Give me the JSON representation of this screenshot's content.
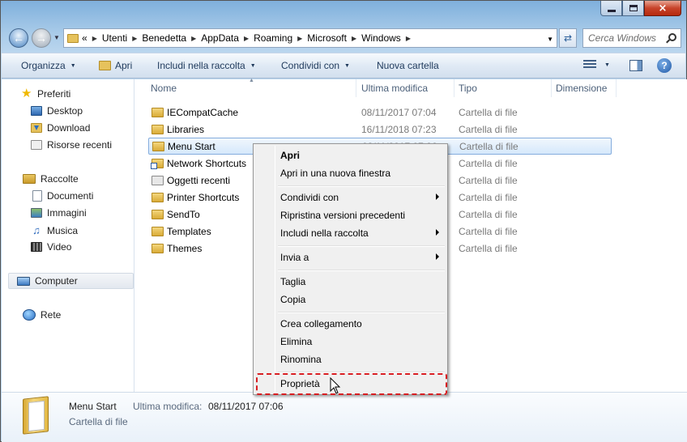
{
  "window": {
    "controls": {
      "minimize": "minimize",
      "maximize": "maximize",
      "close": "×"
    }
  },
  "address_bar": {
    "overflow": "«",
    "breadcrumbs": [
      "Utenti",
      "Benedetta",
      "AppData",
      "Roaming",
      "Microsoft",
      "Windows"
    ]
  },
  "search": {
    "placeholder": "Cerca Windows"
  },
  "toolbar": {
    "organize": "Organizza",
    "open": "Apri",
    "include": "Includi nella raccolta",
    "share": "Condividi con",
    "new_folder": "Nuova cartella"
  },
  "nav_pane": {
    "favorites": {
      "label": "Preferiti",
      "items": [
        "Desktop",
        "Download",
        "Risorse recenti"
      ]
    },
    "libraries": {
      "label": "Raccolte",
      "items": [
        "Documenti",
        "Immagini",
        "Musica",
        "Video"
      ]
    },
    "computer": "Computer",
    "network": "Rete"
  },
  "columns": {
    "name": "Nome",
    "modified": "Ultima modifica",
    "type": "Tipo",
    "size": "Dimensione"
  },
  "files": [
    {
      "name": "IECompatCache",
      "modified": "08/11/2017 07:04",
      "type": "Cartella di file",
      "icon": "folder-icon"
    },
    {
      "name": "Libraries",
      "modified": "16/11/2018 07:23",
      "type": "Cartella di file",
      "icon": "folder-icon"
    },
    {
      "name": "Menu Start",
      "modified": "08/11/2017 07:06",
      "type": "Cartella di file",
      "icon": "folder-icon",
      "selected": true
    },
    {
      "name": "Network Shortcuts",
      "modified": "",
      "type": "Cartella di file",
      "icon": "shortcut-folder-icon"
    },
    {
      "name": "Oggetti recenti",
      "modified": "",
      "type": "Cartella di file",
      "icon": "recent-items-icon"
    },
    {
      "name": "Printer Shortcuts",
      "modified": "",
      "type": "Cartella di file",
      "icon": "folder-icon"
    },
    {
      "name": "SendTo",
      "modified": "",
      "type": "Cartella di file",
      "icon": "folder-icon"
    },
    {
      "name": "Templates",
      "modified": "",
      "type": "Cartella di file",
      "icon": "folder-icon"
    },
    {
      "name": "Themes",
      "modified": "",
      "type": "Cartella di file",
      "icon": "folder-icon"
    }
  ],
  "context_menu": {
    "open": "Apri",
    "open_new_window": "Apri in una nuova finestra",
    "share": "Condividi con",
    "restore_previous": "Ripristina versioni precedenti",
    "include": "Includi nella raccolta",
    "send_to": "Invia a",
    "cut": "Taglia",
    "copy": "Copia",
    "create_shortcut": "Crea collegamento",
    "delete": "Elimina",
    "rename": "Rinomina",
    "properties": "Proprietà"
  },
  "details": {
    "name": "Menu Start",
    "modified_label": "Ultima modifica:",
    "modified_value": "08/11/2017 07:06",
    "type": "Cartella di file"
  },
  "colors": {
    "selection_border": "#84acdd",
    "highlight_dash": "#d81d21",
    "toolbar_text": "#1e395b"
  }
}
